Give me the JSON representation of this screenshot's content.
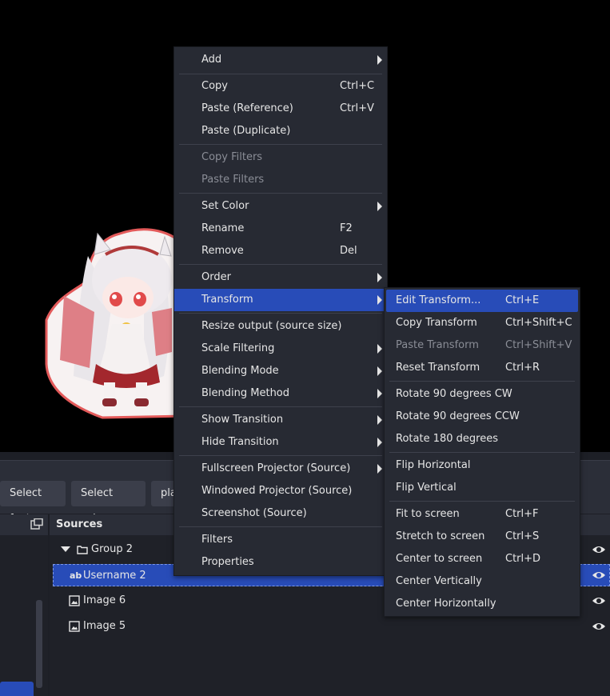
{
  "toolbar": {
    "select_font": "Select font",
    "select_color": "Select color",
    "third_partial": "pla"
  },
  "sources": {
    "title": "Sources",
    "items": [
      {
        "label": "Group 2",
        "icon": "folder-icon"
      },
      {
        "label": "Username 2",
        "icon": "text-source-icon"
      },
      {
        "label": "Image 6",
        "icon": "image-icon"
      },
      {
        "label": "Image 5",
        "icon": "image-icon"
      }
    ]
  },
  "context_menu": {
    "add": "Add",
    "copy": "Copy",
    "copy_sc": "Ctrl+C",
    "paste_ref": "Paste (Reference)",
    "paste_ref_sc": "Ctrl+V",
    "paste_dup": "Paste (Duplicate)",
    "copy_filters": "Copy Filters",
    "paste_filters": "Paste Filters",
    "set_color": "Set Color",
    "rename": "Rename",
    "rename_sc": "F2",
    "remove": "Remove",
    "remove_sc": "Del",
    "order": "Order",
    "transform": "Transform",
    "resize_output": "Resize output (source size)",
    "scale_filtering": "Scale Filtering",
    "blending_mode": "Blending Mode",
    "blending_method": "Blending Method",
    "show_transition": "Show Transition",
    "hide_transition": "Hide Transition",
    "fullscreen_projector": "Fullscreen Projector (Source)",
    "windowed_projector": "Windowed Projector (Source)",
    "screenshot": "Screenshot (Source)",
    "filters": "Filters",
    "properties": "Properties"
  },
  "transform_menu": {
    "edit": "Edit Transform...",
    "edit_sc": "Ctrl+E",
    "copy": "Copy Transform",
    "copy_sc": "Ctrl+Shift+C",
    "paste": "Paste Transform",
    "paste_sc": "Ctrl+Shift+V",
    "reset": "Reset Transform",
    "reset_sc": "Ctrl+R",
    "rot_cw": "Rotate 90 degrees CW",
    "rot_ccw": "Rotate 90 degrees CCW",
    "rot_180": "Rotate 180 degrees",
    "flip_h": "Flip Horizontal",
    "flip_v": "Flip Vertical",
    "fit": "Fit to screen",
    "fit_sc": "Ctrl+F",
    "stretch": "Stretch to screen",
    "stretch_sc": "Ctrl+S",
    "center": "Center to screen",
    "center_sc": "Ctrl+D",
    "center_v": "Center Vertically",
    "center_h": "Center Horizontally"
  },
  "colors": {
    "accent": "#284cb8",
    "menu_bg": "#272a33",
    "panel_bg": "#1f2128"
  }
}
